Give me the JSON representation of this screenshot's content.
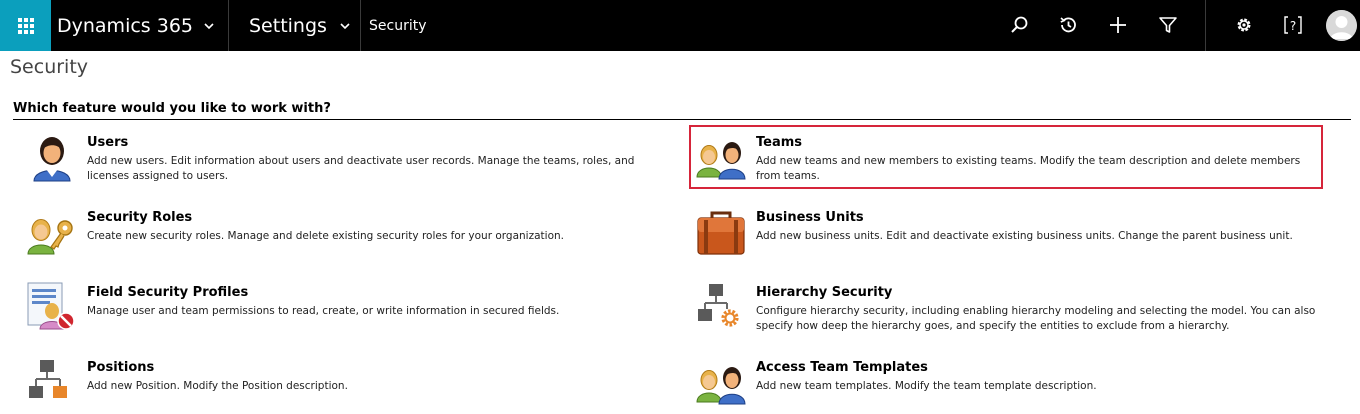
{
  "navbar": {
    "waffle_icon": "app-launcher-icon",
    "app_name": "Dynamics 365",
    "area_name": "Settings",
    "breadcrumb": "Security",
    "brand_color": "#0b9fbd",
    "icons": [
      "search-icon",
      "recent-icon",
      "new-record-icon",
      "advanced-find-icon",
      "settings-gear-icon",
      "help-icon",
      "user-avatar"
    ]
  },
  "page": {
    "title": "Security",
    "question": "Which feature would you like to work with?"
  },
  "features": [
    {
      "title": "Users",
      "description": "Add new users. Edit information about users and deactivate user records. Manage the teams, roles, and licenses assigned to users.",
      "icon": "user-icon"
    },
    {
      "title": "Teams",
      "description": "Add new teams and new members to existing teams. Modify the team description and delete members from teams.",
      "icon": "team-icon",
      "highlighted": true
    },
    {
      "title": "Security Roles",
      "description": "Create new security roles. Manage and delete existing security roles for your organization.",
      "icon": "security-role-key-icon"
    },
    {
      "title": "Business Units",
      "description": "Add new business units. Edit and deactivate existing business units. Change the parent business unit.",
      "icon": "briefcase-icon"
    },
    {
      "title": "Field Security Profiles",
      "description": "Manage user and team permissions to read, create, or write information in secured fields.",
      "icon": "field-security-profile-icon"
    },
    {
      "title": "Hierarchy Security",
      "description": "Configure hierarchy security, including enabling hierarchy modeling and selecting the model. You can also specify how deep the hierarchy goes, and specify the entities to exclude from a hierarchy.",
      "icon": "hierarchy-settings-icon"
    },
    {
      "title": "Positions",
      "description": "Add new Position. Modify the Position description.",
      "icon": "positions-hierarchy-icon"
    },
    {
      "title": "Access Team Templates",
      "description": "Add new team templates. Modify the team template description.",
      "icon": "access-team-template-icon"
    }
  ],
  "colors": {
    "highlight_border": "#d6253a",
    "navbar_bg": "#000000"
  }
}
